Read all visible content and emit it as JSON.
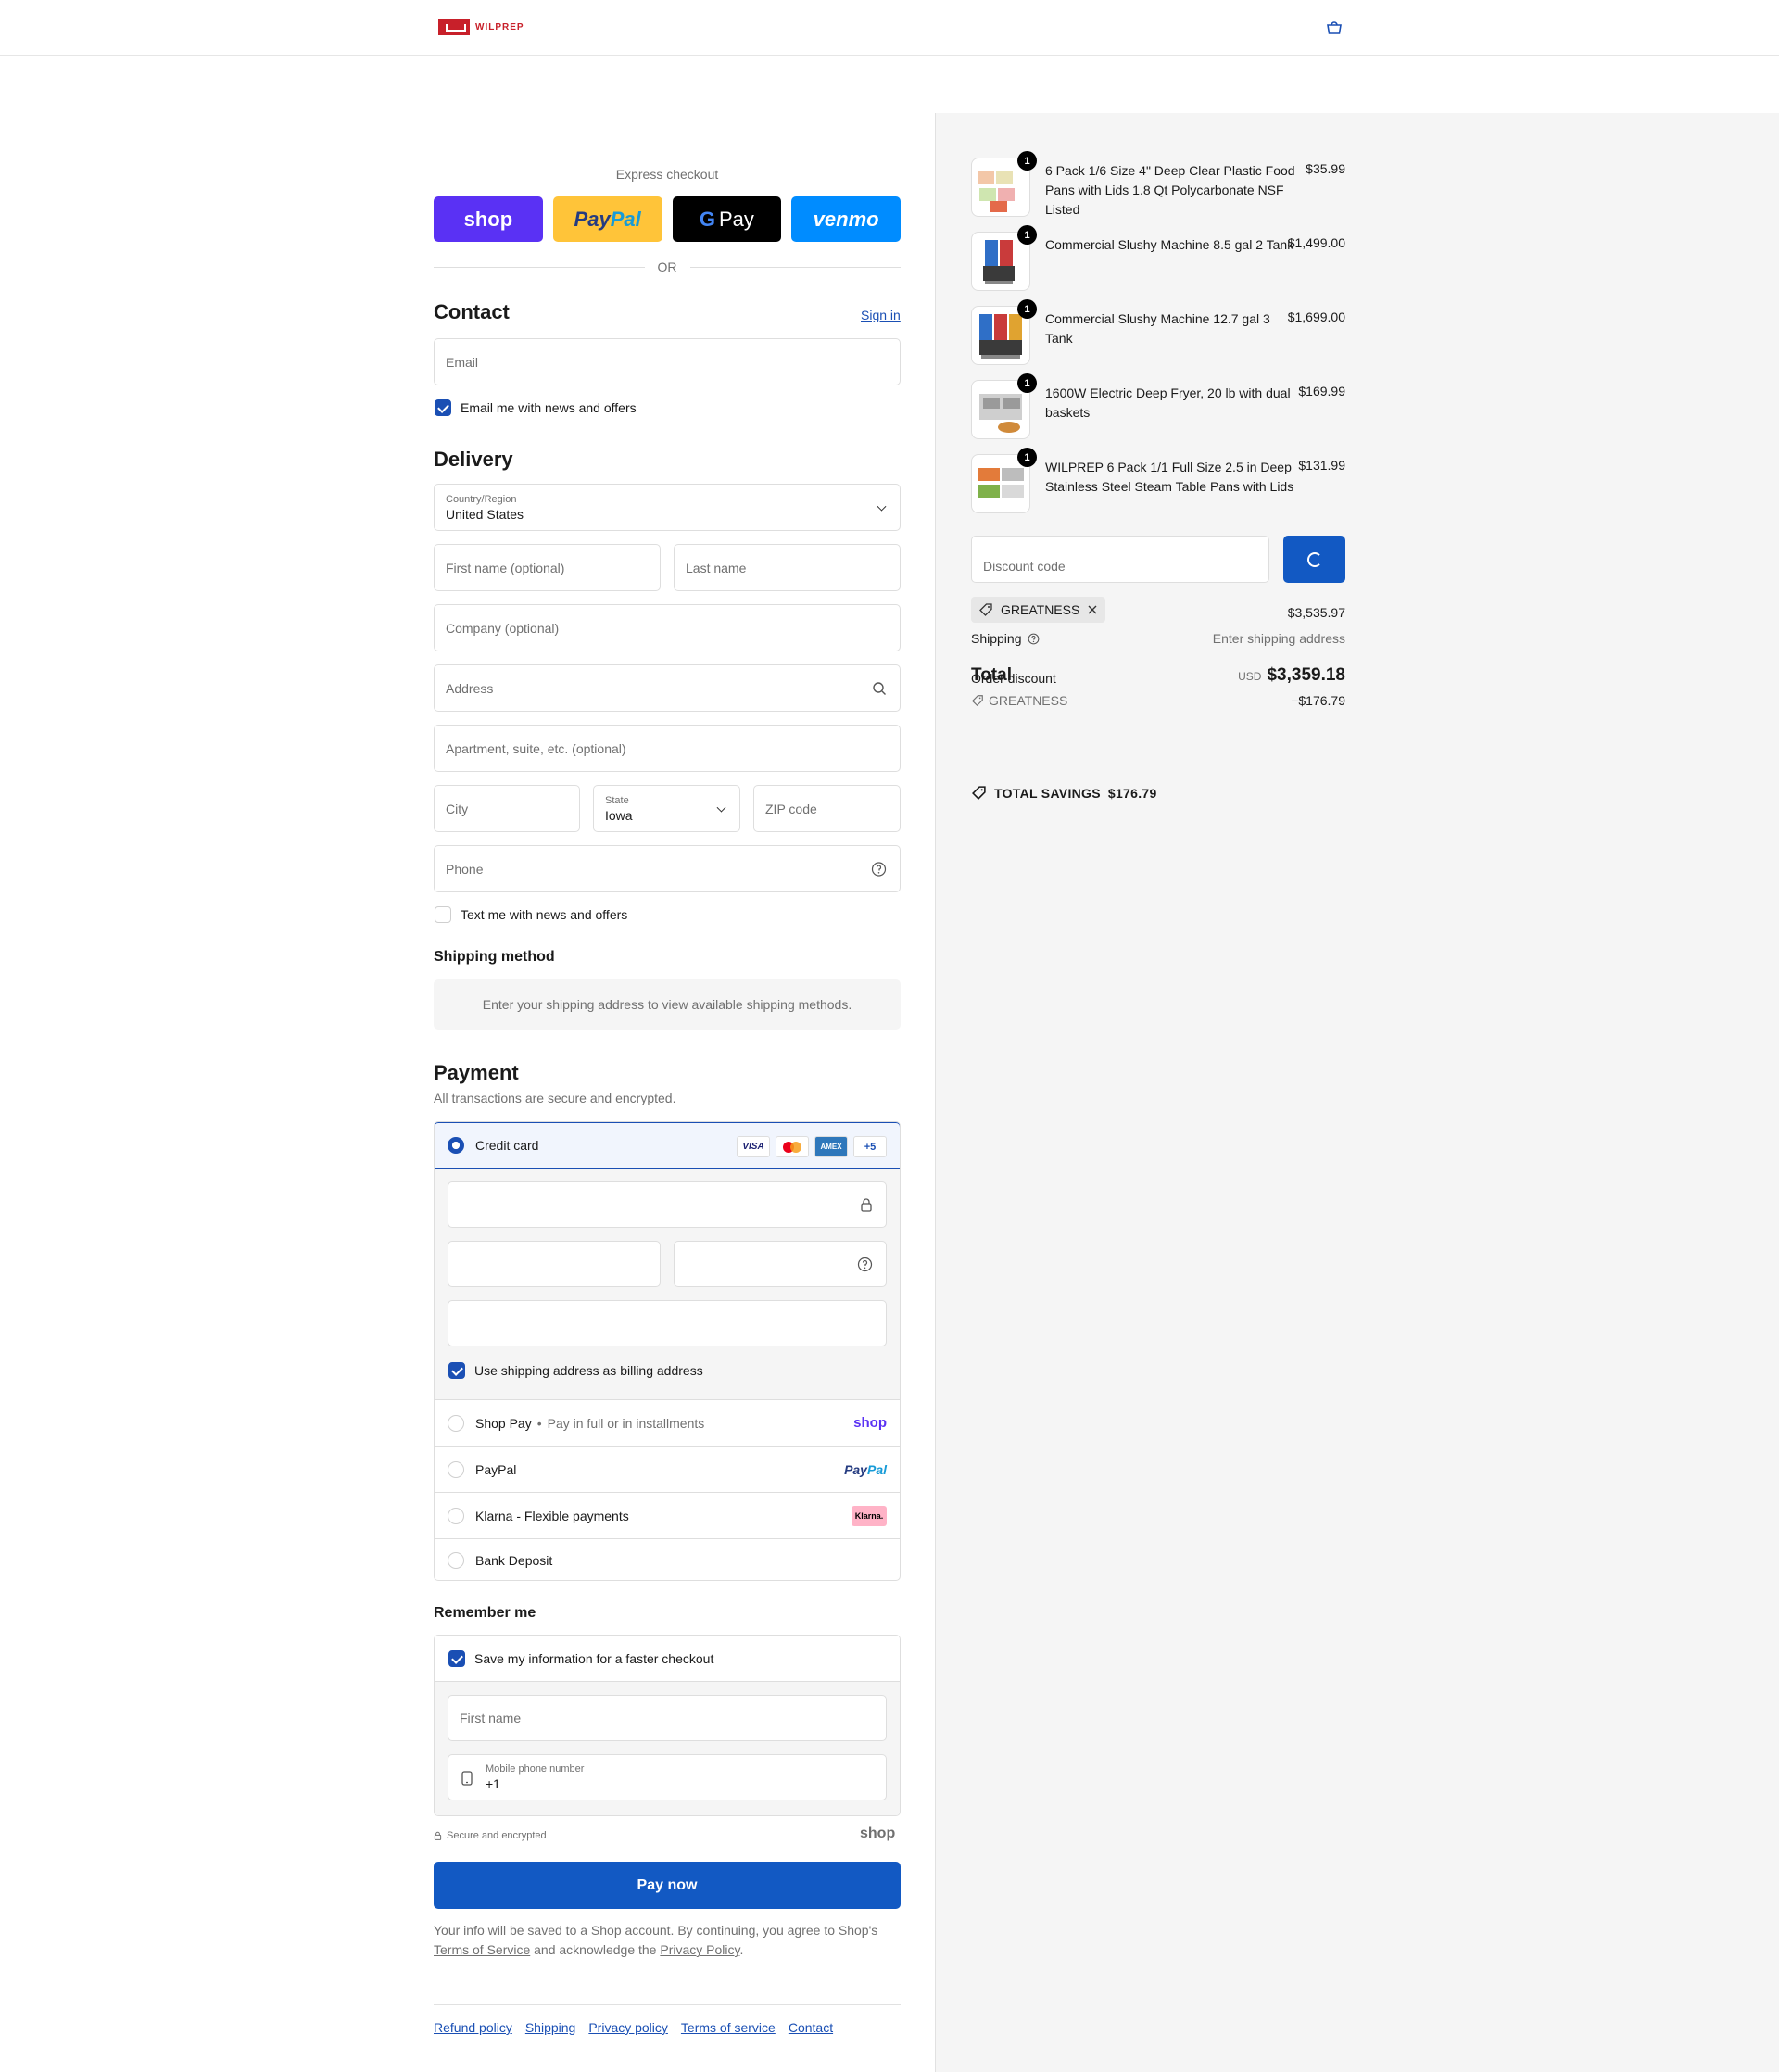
{
  "brand": {
    "name": "WILPREP"
  },
  "express": {
    "title": "Express checkout",
    "shop": "shop",
    "paypal_a": "Pay",
    "paypal_b": "Pal",
    "gpay": "Pay",
    "gpay_g": "G",
    "venmo": "venmo",
    "or": "OR"
  },
  "contact": {
    "title": "Contact",
    "signin": "Sign in",
    "email_placeholder": "Email",
    "news": "Email me with news and offers"
  },
  "delivery": {
    "title": "Delivery",
    "country_label": "Country/Region",
    "country": "United States",
    "first": "First name (optional)",
    "last": "Last name",
    "company": "Company (optional)",
    "address": "Address",
    "apt": "Apartment, suite, etc. (optional)",
    "city": "City",
    "state_label": "State",
    "state": "Iowa",
    "zip": "ZIP code",
    "phone": "Phone",
    "text_news": "Text me with news and offers"
  },
  "shipping_method": {
    "title": "Shipping method",
    "info": "Enter your shipping address to view available shipping methods."
  },
  "payment": {
    "title": "Payment",
    "desc": "All transactions are secure and encrypted.",
    "credit": "Credit card",
    "more_cards": "+5",
    "visa": "VISA",
    "amex": "AMEX",
    "billing": "Use shipping address as billing address",
    "shoppay": "Shop Pay",
    "shoppay_sub": "Pay in full or in installments",
    "shoppay_brand": "shop",
    "paypal": "PayPal",
    "paypal_brand_a": "Pay",
    "paypal_brand_b": "Pal",
    "klarna": "Klarna - Flexible payments",
    "klarna_brand": "Klarna.",
    "bank": "Bank Deposit"
  },
  "remember": {
    "title": "Remember me",
    "save": "Save my information for a faster checkout",
    "first": "First name",
    "mobile_label": "Mobile phone number",
    "mobile_val": "+1",
    "secure": "Secure and encrypted",
    "shop": "shop"
  },
  "paynow": "Pay now",
  "legal": {
    "a": "Your info will be saved to a Shop account. By continuing, you agree to Shop's",
    "tos": "Terms of Service",
    "b": "and acknowledge the",
    "privacy": "Privacy Policy",
    "c": "."
  },
  "footer": [
    "Refund policy",
    "Shipping",
    "Privacy policy",
    "Terms of service",
    "Contact"
  ],
  "cart": {
    "items": [
      {
        "name": "6 Pack 1/6 Size 4\" Deep Clear Plastic Food Pans with Lids 1.8 Qt Polycarbonate NSF Listed",
        "price": "$35.99",
        "qty": "1"
      },
      {
        "name": "Commercial Slushy Machine 8.5 gal 2 Tank",
        "price": "$1,499.00",
        "qty": "1"
      },
      {
        "name": "Commercial Slushy Machine 12.7 gal 3 Tank",
        "price": "$1,699.00",
        "qty": "1"
      },
      {
        "name": "1600W Electric Deep Fryer, 20 lb with dual baskets",
        "price": "$169.99",
        "qty": "1"
      },
      {
        "name": "WILPREP 6 Pack 1/1 Full Size 2.5 in Deep Stainless Steel Steam Table Pans with Lids",
        "price": "$131.99",
        "qty": "1"
      }
    ],
    "discount_placeholder": "Discount code",
    "code": "GREATNESS",
    "subtotal": "$3,535.97",
    "shipping_label": "Shipping",
    "shipping_val": "Enter shipping address",
    "total_label": "Total",
    "currency": "USD",
    "total": "$3,359.18",
    "order_discount": "Order discount",
    "discount_code": "GREATNESS",
    "discount_amt": "−$176.79",
    "savings_label": "TOTAL SAVINGS",
    "savings": "$176.79"
  }
}
